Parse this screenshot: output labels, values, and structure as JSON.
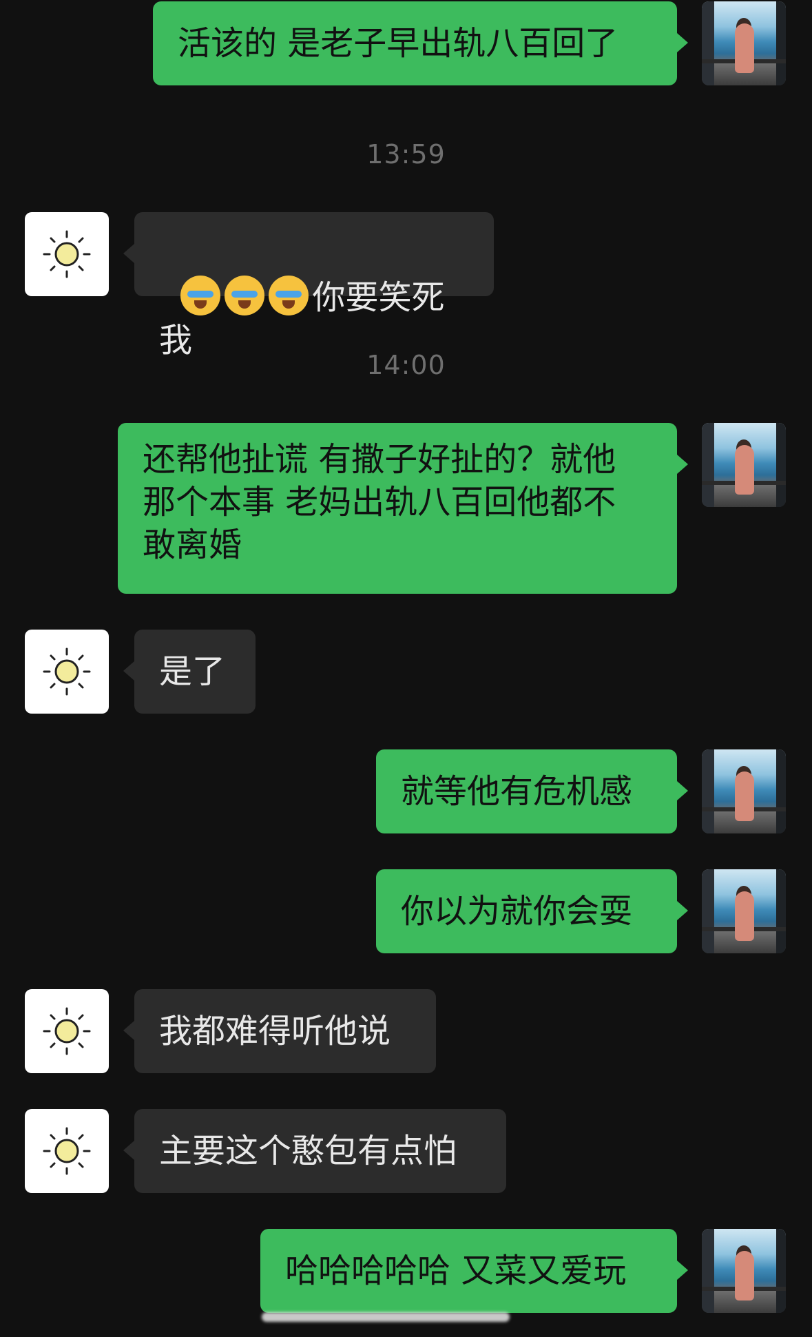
{
  "messages": [
    {
      "type": "out",
      "text": "活该的 是老子早出轨八百回了"
    },
    {
      "type": "time",
      "text": "13:59"
    },
    {
      "type": "in",
      "emoji_count": 3,
      "text": "你要笑死我"
    },
    {
      "type": "time",
      "text": "14:00"
    },
    {
      "type": "out",
      "text": "还帮他扯谎 有撒子好扯的？就他\n那个本事 老妈出轨八百回他都不\n敢离婚"
    },
    {
      "type": "in",
      "text": "是了"
    },
    {
      "type": "out",
      "text": "就等他有危机感"
    },
    {
      "type": "out",
      "text": "你以为就你会耍"
    },
    {
      "type": "in",
      "text": "我都难得听他说"
    },
    {
      "type": "in",
      "text": "主要这个憨包有点怕"
    },
    {
      "type": "out",
      "text": "哈哈哈哈哈 又菜又爱玩"
    }
  ],
  "icons": {
    "contact_avatar": "sun-icon",
    "self_avatar": "photo-avatar",
    "emoji": "face-with-tears-emoji"
  },
  "colors": {
    "background": "#111111",
    "outgoing_bubble": "#3dbb5d",
    "incoming_bubble": "#2c2c2c",
    "timestamp": "#6f6f6f"
  }
}
